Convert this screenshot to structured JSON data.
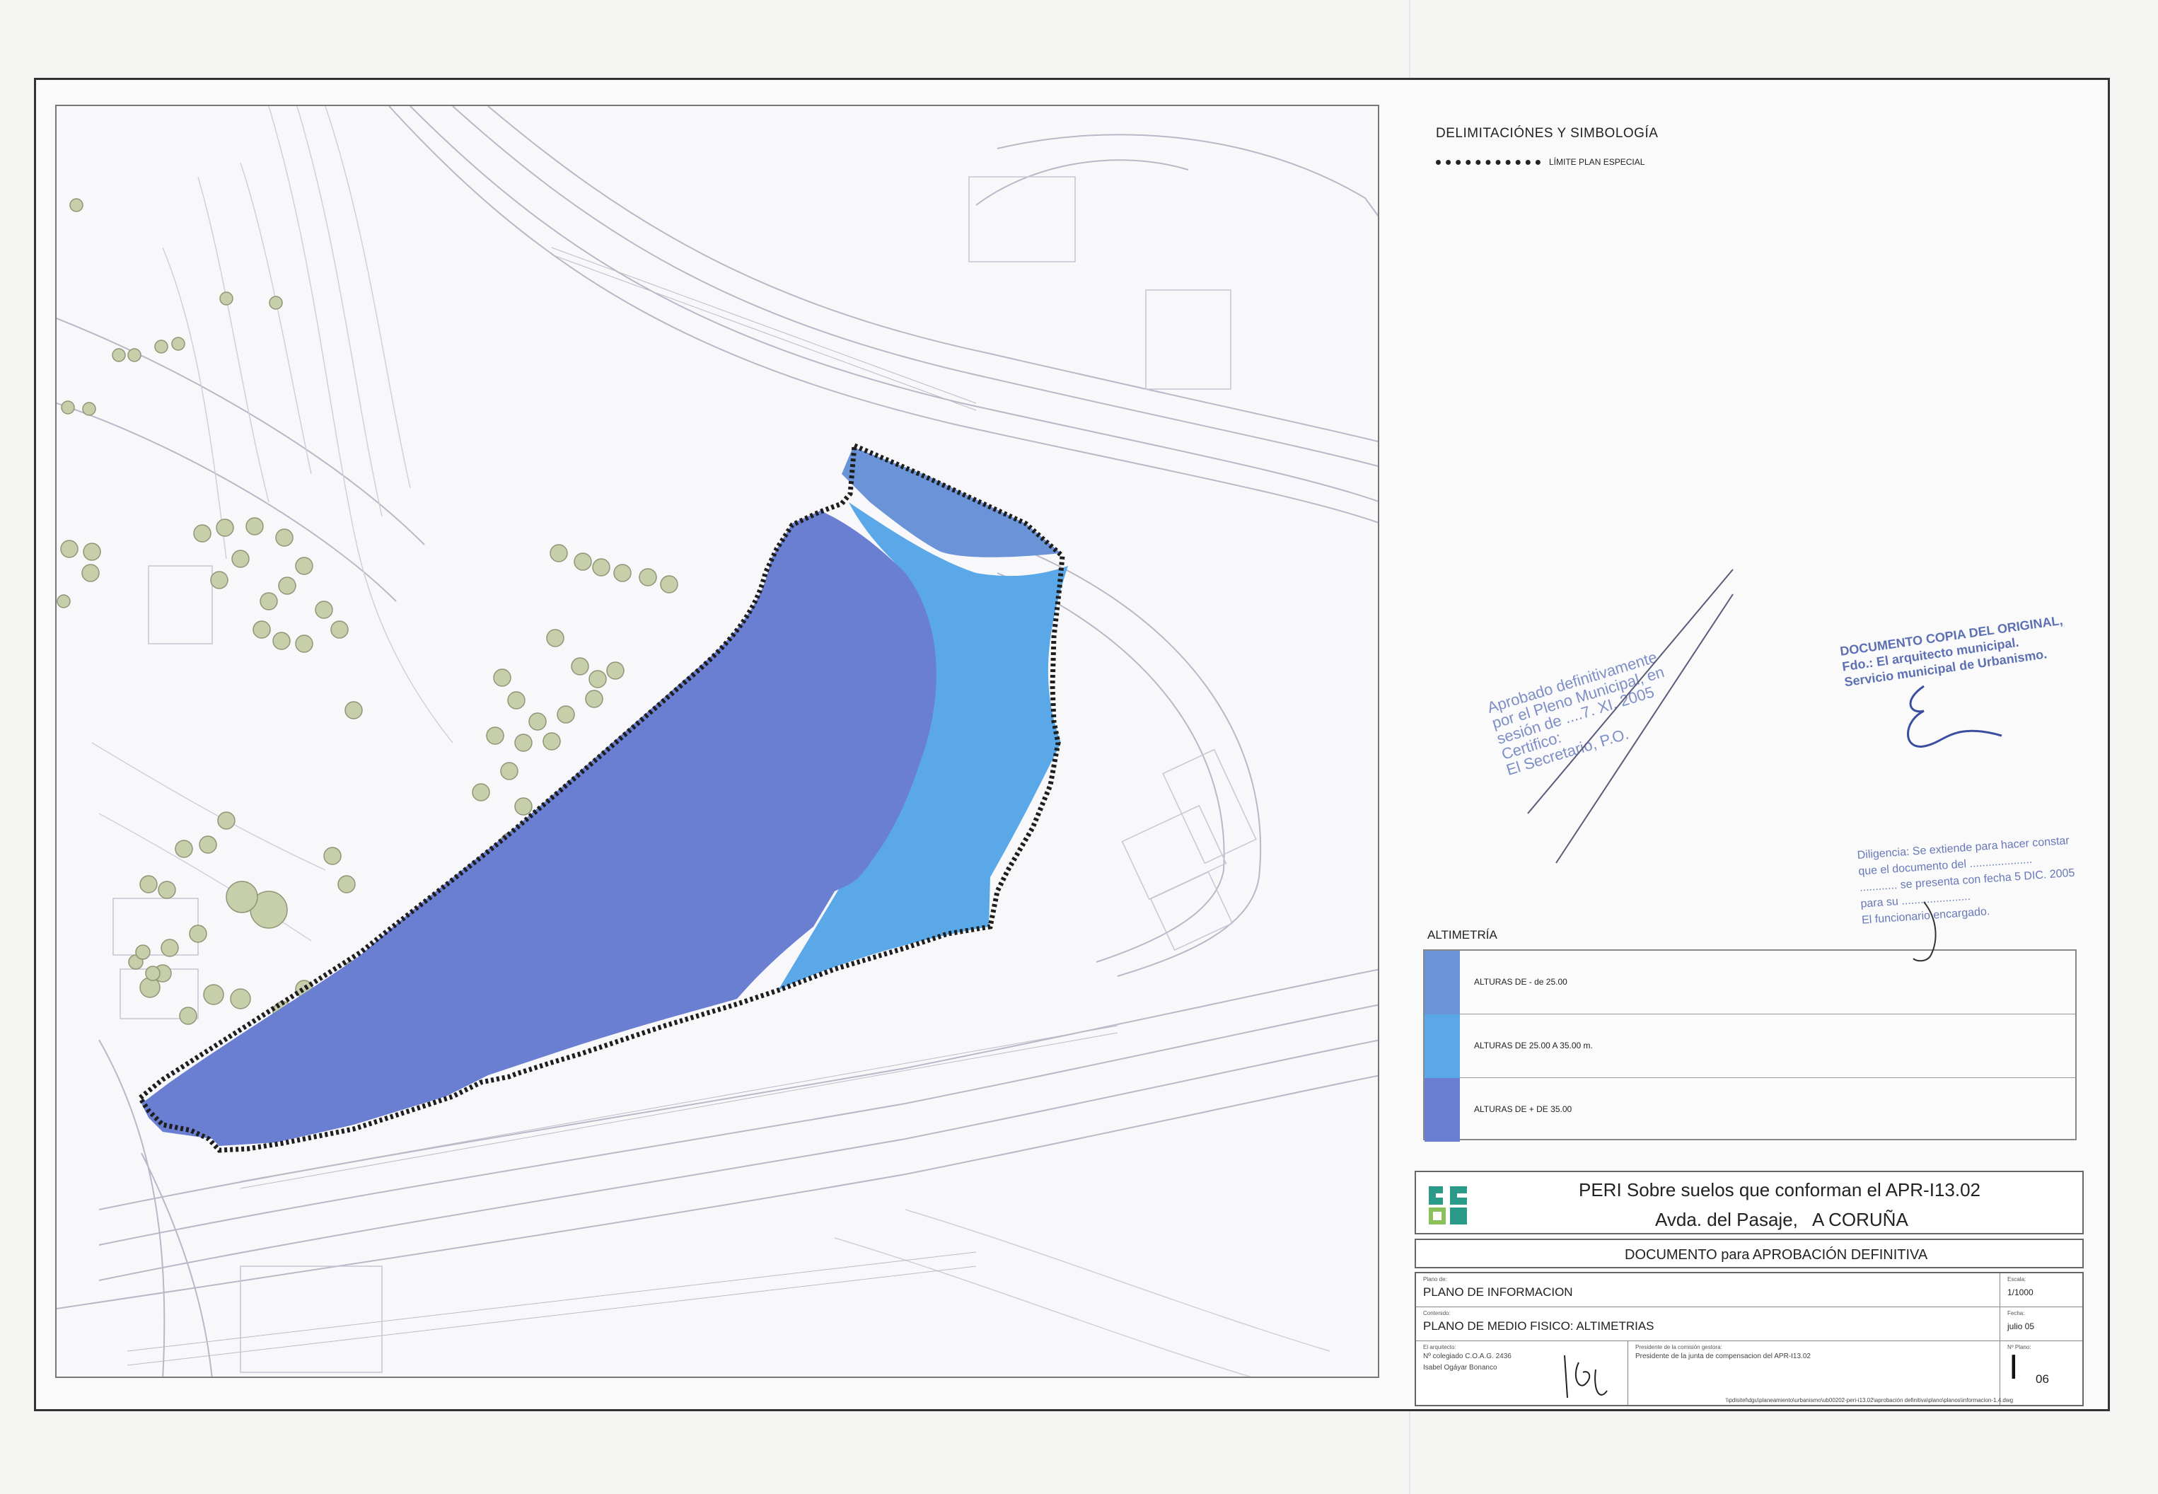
{
  "legend": {
    "heading": "DELIMITACIÓNES Y SIMBOLOGÍA",
    "boundary_label": "LÍMITE PLAN ESPECIAL"
  },
  "altimetria": {
    "title": "ALTIMETRÍA",
    "rows": [
      {
        "label": "ALTURAS DE - de 25.00",
        "color": "#6b93d8"
      },
      {
        "label": "ALTURAS DE 25.00 A 35.00 m.",
        "color": "#5aa8e8"
      },
      {
        "label": "ALTURAS DE + DE 35.00",
        "color": "#6a7fd2"
      }
    ]
  },
  "project": {
    "line1": "PERI Sobre suelos que conforman el APR-I13.02",
    "line2": "Avda. del Pasaje,",
    "city": "A CORUÑA",
    "document": "DOCUMENTO para APROBACIÓN DEFINITIVA"
  },
  "info": {
    "plano_caption": "Plano de:",
    "plano_value": "PLANO DE INFORMACION",
    "contenido_caption": "Contenido:",
    "contenido_value": "PLANO DE MEDIO FISICO: ALTIMETRIAS",
    "escala_caption": "Escala:",
    "escala_value": "1/1000",
    "fecha_caption": "Fecha:",
    "fecha_value": "julio 05",
    "arquitecto_caption": "El arquitecto:",
    "arquitecto_line1": "Nº colegiado C.O.A.G. 2436",
    "arquitecto_line2": "Isabel Ogáyar Bonanco",
    "presidente_caption": "Presidente de la comisión gestora:",
    "presidente_value": "Presidente de la junta de compensacion del APR-I13.02",
    "plano_num_caption": "Nº Plano:",
    "plano_num_main": "I",
    "plano_num_sub": "06",
    "file_path": "\\\\pdisitel\\dgu\\planeamiento\\urbanismo\\ub00202-peri-i13.02\\aprobación definitiva\\plano\\planos\\informacion-1.4.dwg"
  },
  "stamps": {
    "aprobado": [
      "Aprobado definitivamente",
      "por el Pleno Municipal, en",
      "sesión de ....7. XI. 2005",
      "Certifico:",
      "El Secretario, P.O."
    ],
    "copia": [
      "DOCUMENTO COPIA DEL ORIGINAL,",
      "Fdo.: El arquitecto municipal.",
      "Servicio municipal de Urbanismo."
    ],
    "diligencia": [
      "Diligencia: Se extiende para hacer constar",
      "que el documento del ....................",
      "............ se presenta con fecha 5 DIC. 2005",
      "para su ......................",
      "El funcionario encargado."
    ]
  },
  "map": {
    "colors": {
      "zone_low": "#6b93d8",
      "zone_mid": "#5aa8e8",
      "zone_high": "#6a7fd2",
      "tree": "#c7ceaa"
    }
  }
}
